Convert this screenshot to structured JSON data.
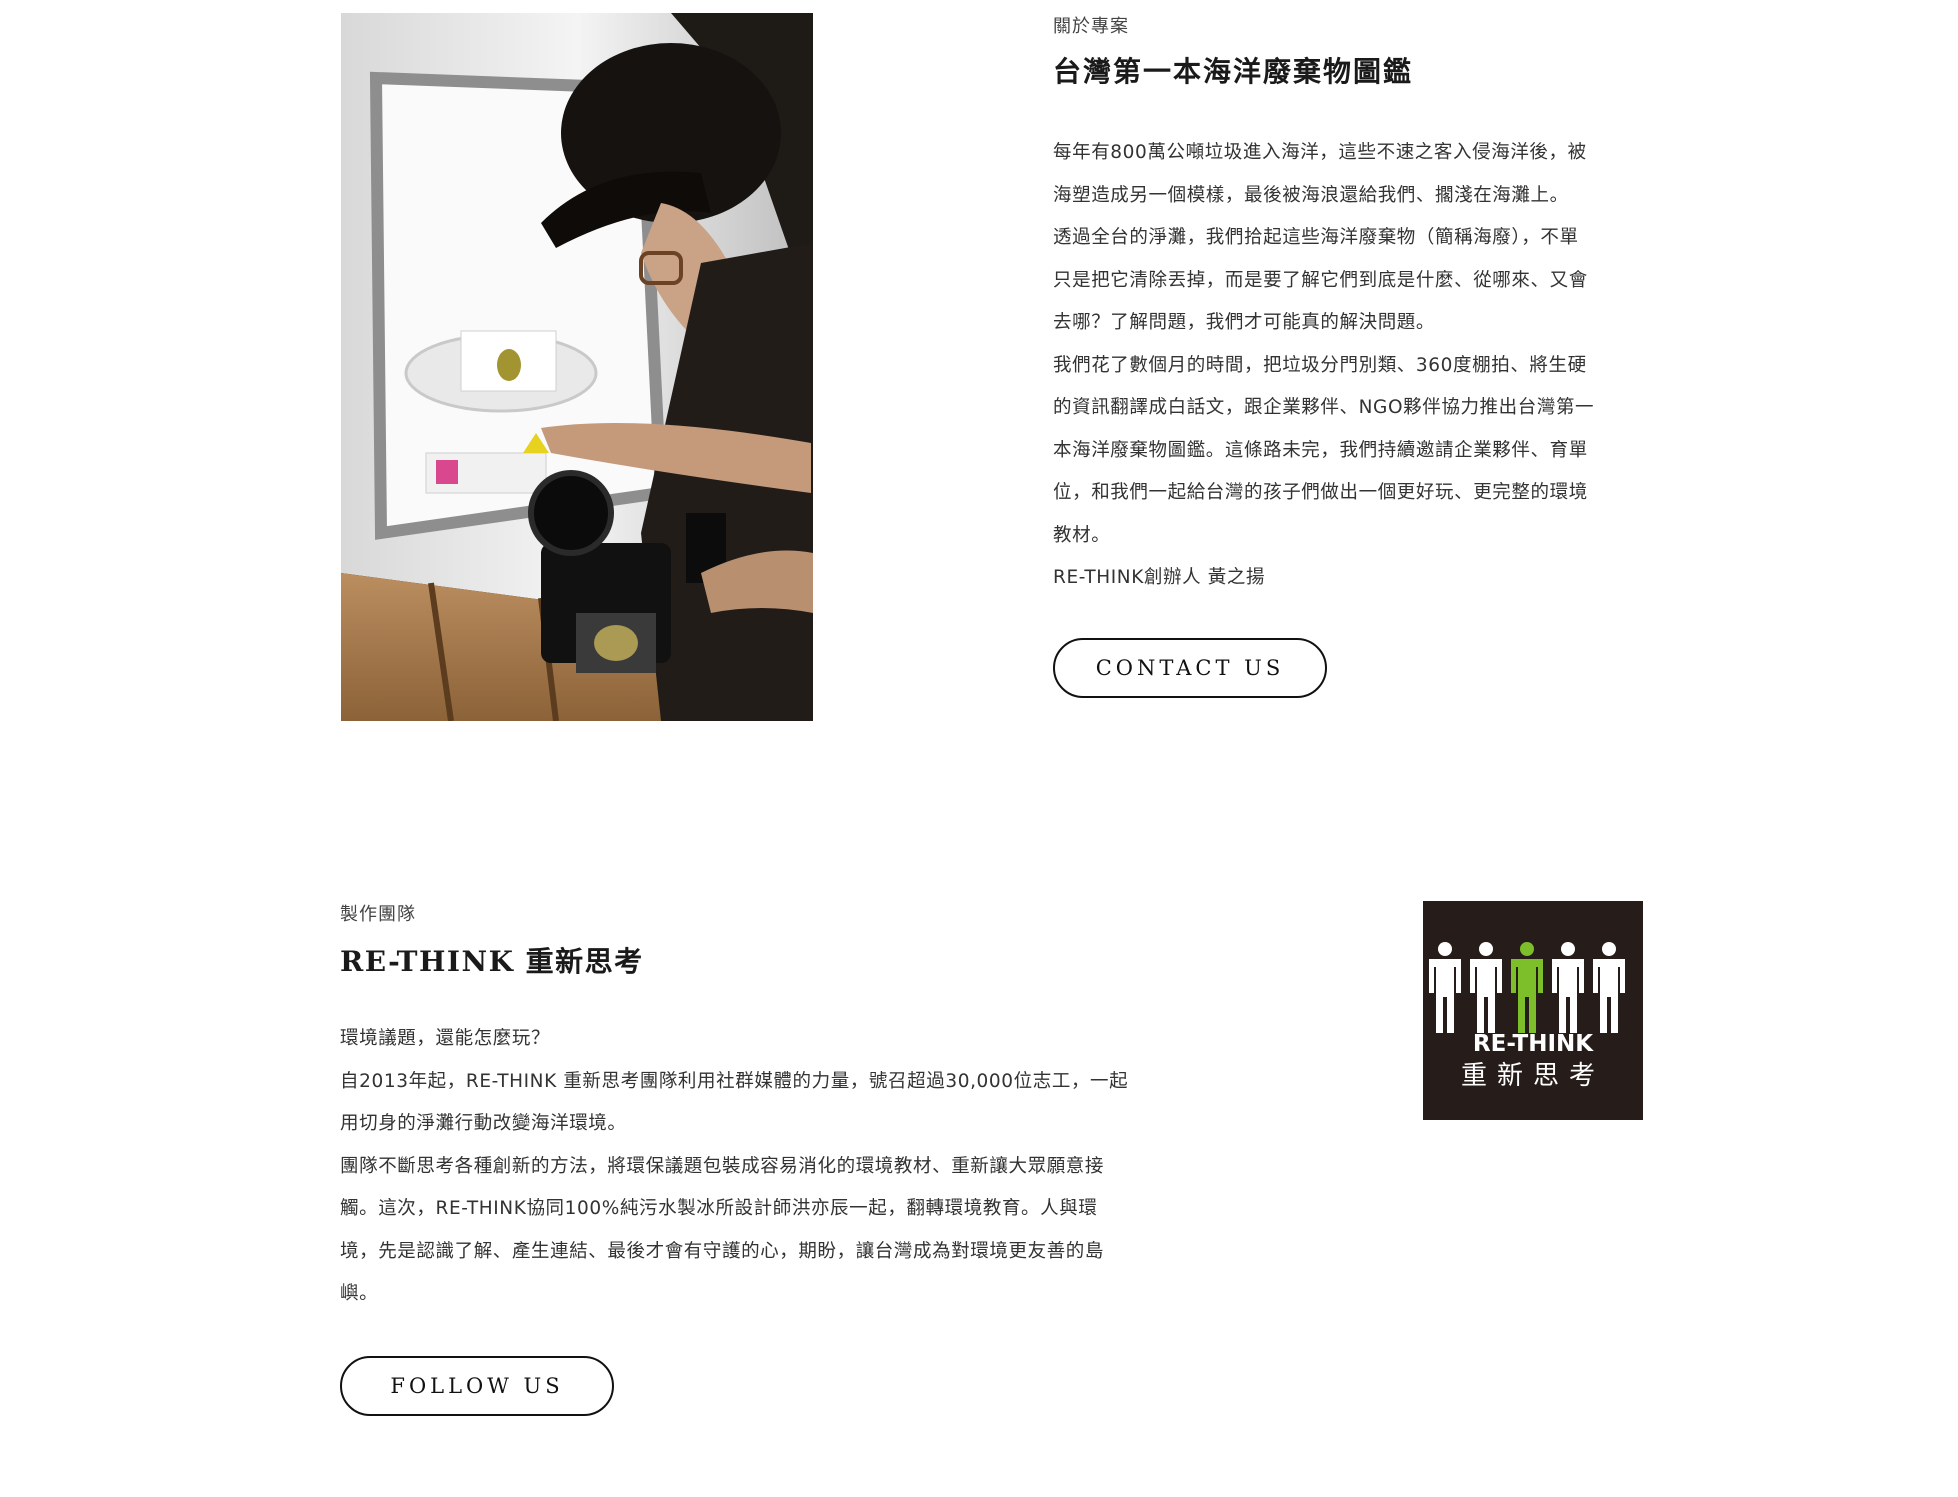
{
  "about": {
    "eyebrow": "關於專案",
    "title": "台灣第一本海洋廢棄物圖鑑",
    "paragraphs": [
      "每年有800萬公噸垃圾進入海洋，這些不速之客入侵海洋後，被",
      "海塑造成另一個模樣，最後被海浪還給我們、擱淺在海灘上。",
      "透過全台的淨灘，我們拾起這些海洋廢棄物（簡稱海廢），不單",
      "只是把它清除丟掉，而是要了解它們到底是什麼、從哪來、又會",
      "去哪？了解問題，我們才可能真的解決問題。",
      "我們花了數個月的時間，把垃圾分門別類、360度棚拍、將生硬",
      "的資訊翻譯成白話文，跟企業夥伴、NGO夥伴協力推出台灣第一",
      "本海洋廢棄物圖鑑。這條路未完，我們持續邀請企業夥伴、育單",
      "位，和我們一起給台灣的孩子們做出一個更好玩、更完整的環境",
      "教材。",
      "RE-THINK創辦人 黃之揚"
    ],
    "button_label": "CONTACT US"
  },
  "team": {
    "eyebrow": "製作團隊",
    "title": "RE-THINK 重新思考",
    "paragraphs": [
      "環境議題，還能怎麼玩？",
      "自2013年起，RE-THINK 重新思考團隊利用社群媒體的力量，號召超過30,000位志工，一起",
      "用切身的淨灘行動改變海洋環境。",
      "團隊不斷思考各種創新的方法，將環保議題包裝成容易消化的環境教材、重新讓大眾願意接",
      "觸。這次，RE-THINK協同100%純污水製冰所設計師洪亦辰一起，翻轉環境教育。人與環",
      "境，先是認識了解、產生連結、最後才會有守護的心，期盼，讓台灣成為對環境更友善的島",
      "嶼。"
    ],
    "button_label": "FOLLOW US"
  },
  "logo": {
    "wordmark_en": "RE-THINK",
    "wordmark_zh": "重新思考",
    "figure_color": "#ffffff",
    "accent_color": "#7cbf2a",
    "background_color": "#261d1b"
  },
  "photo": {
    "icon": "photographer-light-box-photo"
  }
}
